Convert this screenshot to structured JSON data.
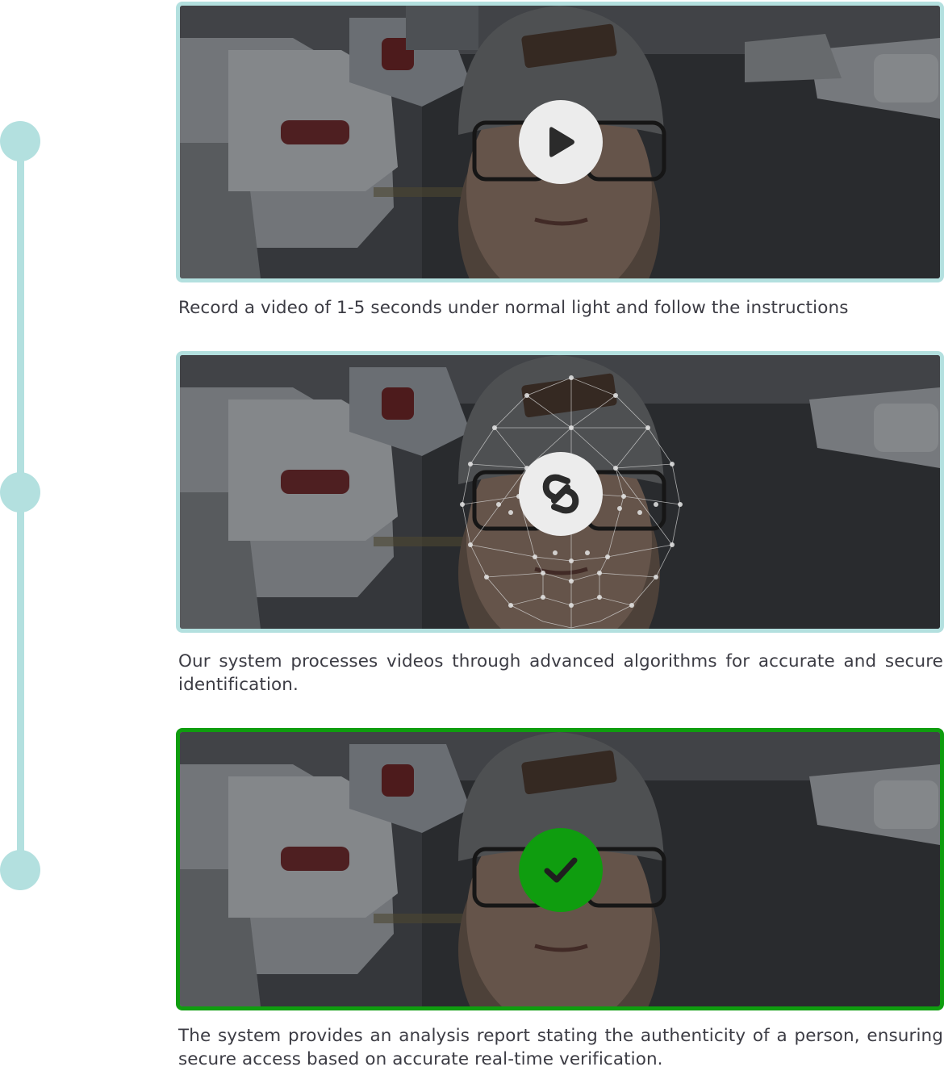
{
  "timeline": {
    "color": "#b3e0df",
    "steps": 3
  },
  "steps": [
    {
      "icon": "play-icon",
      "frame_color": "#b3e0df",
      "caption": "Record a video of 1-5 seconds under normal light and follow the instructions"
    },
    {
      "icon": "processing-link-icon",
      "frame_color": "#b3e0df",
      "caption": "Our system processes videos through advanced algorithms for accurate and secure identification."
    },
    {
      "icon": "checkmark-icon",
      "frame_color": "#0f9d0f",
      "caption": "The system provides an analysis report stating the authenticity of a person, ensuring secure access based on accurate real-time verification."
    }
  ],
  "colors": {
    "accent_teal": "#b3e0df",
    "success_green": "#0f9d0f",
    "text": "#3c3c44"
  }
}
